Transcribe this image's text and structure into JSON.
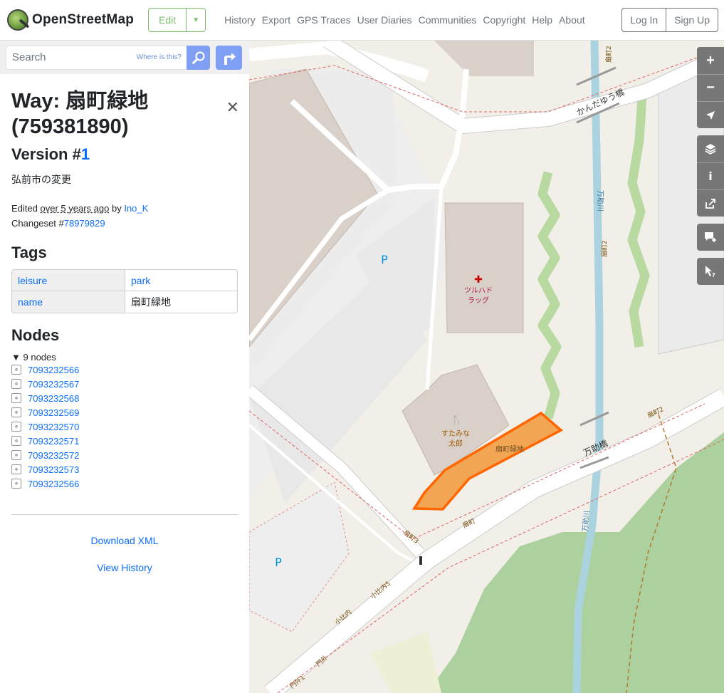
{
  "header": {
    "logo_text": "OpenStreetMap",
    "edit_label": "Edit",
    "nav": [
      "History",
      "Export",
      "GPS Traces",
      "User Diaries",
      "Communities",
      "Copyright",
      "Help",
      "About"
    ],
    "login": "Log In",
    "signup": "Sign Up"
  },
  "search": {
    "placeholder": "Search",
    "where_label": "Where is this?"
  },
  "feature": {
    "title": "Way: 扇町緑地 (759381890)",
    "version_prefix": "Version #",
    "version_number": "1",
    "comment": "弘前市の変更",
    "edited_prefix": "Edited",
    "edited_time": "over 5 years ago",
    "edited_by": "by",
    "user": "Ino_K",
    "changeset_prefix": "Changeset #",
    "changeset_id": "78979829"
  },
  "tags_heading": "Tags",
  "tags": [
    {
      "key": "leisure",
      "value": "park"
    },
    {
      "key": "name",
      "value": "扇町緑地"
    }
  ],
  "nodes_heading": "Nodes",
  "nodes_summary": "9 nodes",
  "nodes": [
    "7093232566",
    "7093232567",
    "7093232568",
    "7093232569",
    "7093232570",
    "7093232571",
    "7093232572",
    "7093232573",
    "7093232566"
  ],
  "links": {
    "download": "Download XML",
    "history": "View History"
  },
  "map_labels": {
    "bridge1": "かんだゆう橋",
    "bridge2": "万助橋",
    "pharmacy": "ツルハドラッグ",
    "pharmacy_l1": "ツルハド",
    "pharmacy_l2": "ラッグ",
    "restaurant_l1": "すたみな",
    "restaurant_l2": "太郎",
    "park": "扇町緑地",
    "parking": "P",
    "river": "万助川",
    "st_ogi2": "扇町2",
    "st_ogi3": "扇町3",
    "st_ogi": "扇町",
    "st_kohi5": "小比内5",
    "st_kohi": "小比内",
    "st_mon": "門外",
    "st_mon1": "門外1"
  },
  "colors": {
    "accent": "#7ebc6f",
    "link": "#0d6efd",
    "highlight": "#ff6600",
    "river": "#aad3df",
    "park_green": "#add19e"
  }
}
